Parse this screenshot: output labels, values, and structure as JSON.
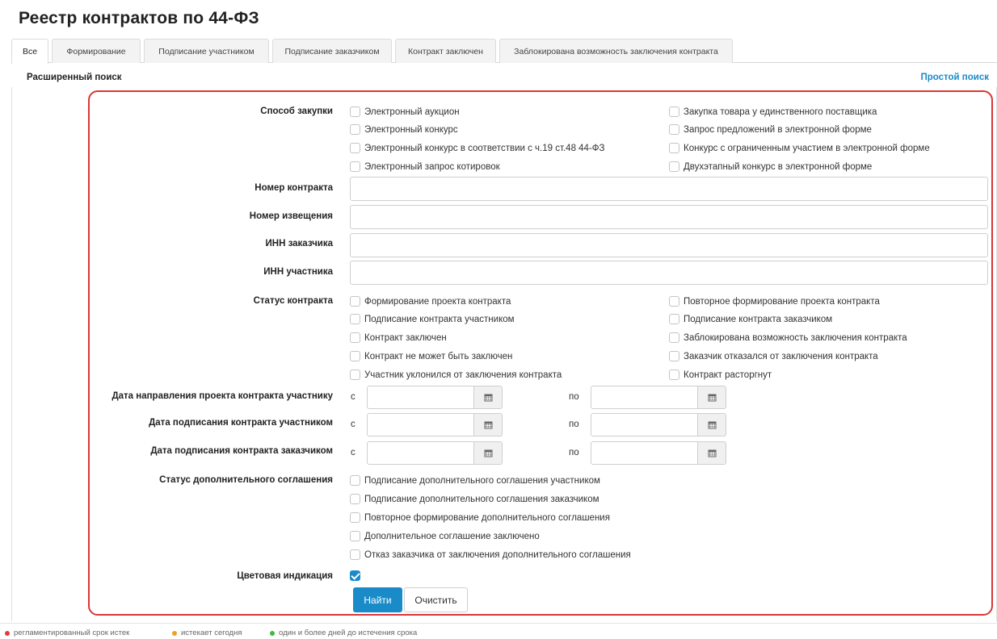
{
  "page": {
    "title": "Реестр контрактов по 44-ФЗ"
  },
  "tabs": [
    "Все",
    "Формирование",
    "Подписание участником",
    "Подписание заказчиком",
    "Контракт заключен",
    "Заблокирована возможность заключения контракта"
  ],
  "search": {
    "advanced_title": "Расширенный поиск",
    "simple_link": "Простой поиск"
  },
  "purchase_method": {
    "label": "Способ закупки",
    "options": [
      "Электронный аукцион",
      "Электронный конкурс",
      "Электронный конкурс в соответствии с ч.19 ст.48 44-ФЗ",
      "Электронный запрос котировок",
      "Закупка товара у единственного поставщика",
      "Запрос предложений в электронной форме",
      "Конкурс с ограниченным участием в электронной форме",
      "Двухэтапный конкурс в электронной форме"
    ]
  },
  "fields": {
    "contract_number": {
      "label": "Номер контракта",
      "value": ""
    },
    "notice_number": {
      "label": "Номер извещения",
      "value": ""
    },
    "customer_inn": {
      "label": "ИНН заказчика",
      "value": ""
    },
    "participant_inn": {
      "label": "ИНН участника",
      "value": ""
    }
  },
  "contract_status": {
    "label": "Статус контракта",
    "options": [
      "Формирование проекта контракта",
      "Подписание контракта участником",
      "Контракт заключен",
      "Контракт не может быть заключен",
      "Участник уклонился от заключения контракта",
      "Повторное формирование проекта контракта",
      "Подписание контракта заказчиком",
      "Заблокирована возможность заключения контракта",
      "Заказчик отказался от заключения контракта",
      "Контракт расторгнут"
    ]
  },
  "date_ranges": {
    "from_label": "с",
    "to_label": "по",
    "rows": [
      {
        "label": "Дата направления проекта контракта участнику",
        "from": "",
        "to": ""
      },
      {
        "label": "Дата подписания контракта участником",
        "from": "",
        "to": ""
      },
      {
        "label": "Дата подписания контракта заказчиком",
        "from": "",
        "to": ""
      }
    ]
  },
  "supplement_status": {
    "label": "Статус дополнительного соглашения",
    "options": [
      "Подписание дополнительного соглашения участником",
      "Подписание дополнительного соглашения заказчиком",
      "Повторное формирование дополнительного соглашения",
      "Дополнительное соглашение заключено",
      "Отказ заказчика от заключения дополнительного соглашения"
    ]
  },
  "color_indication": {
    "label": "Цветовая индикация",
    "checked": true
  },
  "buttons": {
    "find": "Найти",
    "clear": "Очистить"
  },
  "legend": [
    {
      "text": "регламентированный срок истек",
      "color": "#e23b3b"
    },
    {
      "text": "истекает сегодня",
      "color": "#f0a020"
    },
    {
      "text": "один и более дней до истечения срока",
      "color": "#3cbb3c"
    }
  ],
  "colors": {
    "accent": "#1a8bc9",
    "highlight_border": "#d93636"
  }
}
